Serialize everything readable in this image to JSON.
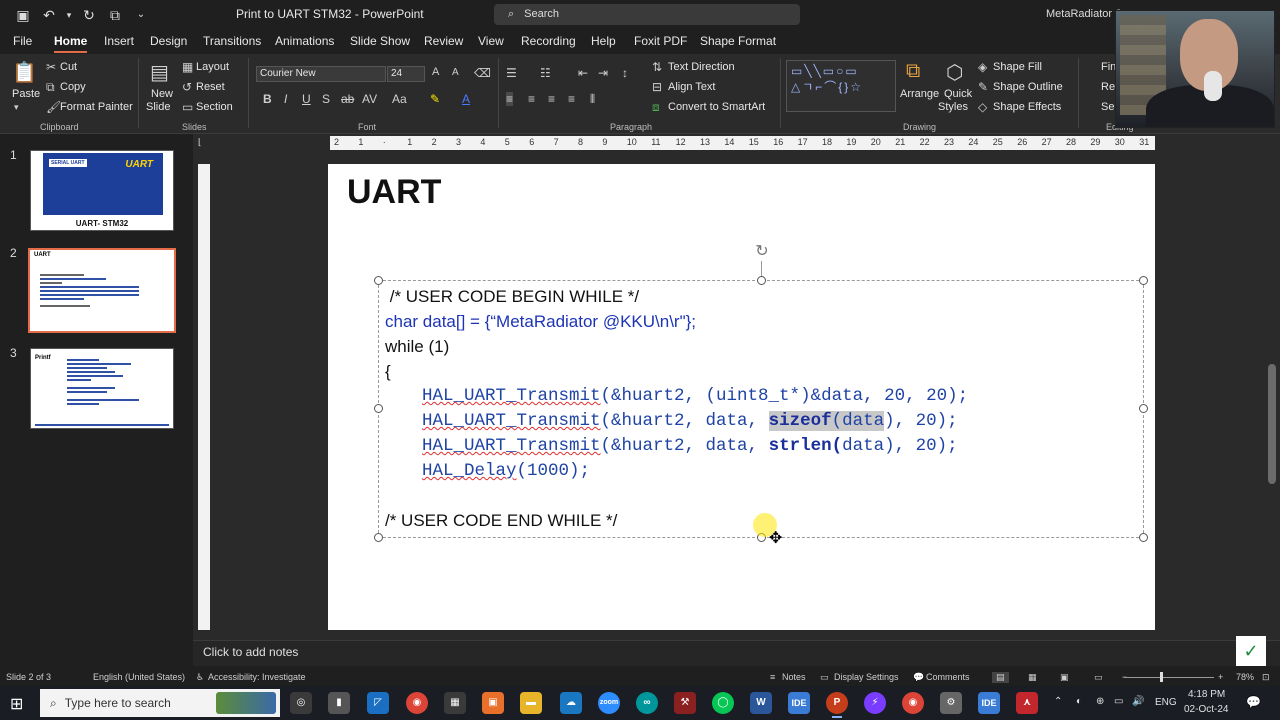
{
  "window": {
    "title": "Print to UART STM32  -  PowerPoint",
    "search_placeholder": "Search",
    "user": "MetaRadiator J"
  },
  "menu": {
    "tabs": [
      "File",
      "Home",
      "Insert",
      "Design",
      "Transitions",
      "Animations",
      "Slide Show",
      "Review",
      "View",
      "Recording",
      "Help",
      "Foxit PDF",
      "Shape Format"
    ],
    "active": "Home"
  },
  "ribbon": {
    "clipboard": {
      "paste": "Paste",
      "cut": "Cut",
      "copy": "Copy",
      "format_painter": "Format Painter",
      "label": "Clipboard"
    },
    "slides": {
      "new_slide": "New",
      "new_slide_2": "Slide",
      "layout": "Layout",
      "reset": "Reset",
      "section": "Section",
      "label": "Slides"
    },
    "font": {
      "name": "Courier New",
      "size": "24",
      "label": "Font"
    },
    "paragraph": {
      "text_direction": "Text Direction",
      "align_text": "Align Text",
      "convert_smartart": "Convert to SmartArt",
      "label": "Paragraph"
    },
    "drawing": {
      "arrange": "Arrange",
      "quick": "Quick",
      "styles": "Styles",
      "shape_fill": "Shape Fill",
      "shape_outline": "Shape Outline",
      "shape_effects": "Shape Effects",
      "label": "Drawing"
    },
    "editing": {
      "find": "Fin",
      "replace": "Rep",
      "select": "Sel",
      "label": "Editing"
    }
  },
  "thumbnails": [
    {
      "num": "1",
      "badge": "SERIAL UART",
      "title": "UART",
      "caption": "UART- STM32"
    },
    {
      "num": "2",
      "title": "UART"
    },
    {
      "num": "3",
      "title": "Printf"
    }
  ],
  "ruler": [
    "2",
    "1",
    "",
    "1",
    "2",
    "3",
    "4",
    "5",
    "6",
    "7",
    "8",
    "9",
    "10",
    "11",
    "12",
    "13",
    "14",
    "15",
    "16",
    "17",
    "18",
    "19",
    "20",
    "21",
    "22",
    "23",
    "24",
    "25",
    "26",
    "27",
    "28",
    "29",
    "30",
    "31"
  ],
  "slide": {
    "title": "UART",
    "lines": {
      "l1": " /* USER CODE BEGIN WHILE */",
      "l2": "char data[] = {“MetaRadiator @KKU\\n\\r\"};",
      "l3": "while (1)",
      "l4": "{",
      "l5_fn": "HAL_UART_Transmit",
      "l5_rest": "(&huart2, (uint8_t*)&data, 20, 20);",
      "l6_fn": "HAL_UART_Transmit",
      "l6_mid": "(&huart2, data, ",
      "l6_kw": "sizeof",
      "l6_arg": "(data",
      "l6_end": "), 20);",
      "l7_fn": "HAL_UART_Transmit",
      "l7_mid": "(&huart2, data, ",
      "l7_kw": "strlen(",
      "l7_end": "data), 20);",
      "l8_fn": "HAL_Delay",
      "l8_rest": "(1000);",
      "l9": "/* USER CODE END WHILE */"
    }
  },
  "notes_placeholder": "Click to add notes",
  "status": {
    "slide_of": "Slide 2 of 3",
    "language": "English (United States)",
    "accessibility": "Accessibility: Investigate",
    "notes": "Notes",
    "display_settings": "Display Settings",
    "comments": "Comments",
    "zoom": "78%"
  },
  "taskbar": {
    "search_placeholder": "Type here to search",
    "lang": "ENG",
    "time": "4:18 PM",
    "date": "02-Oct-24"
  },
  "colors": {
    "accent": "#e46c4a",
    "code_blue": "#2044a6"
  }
}
